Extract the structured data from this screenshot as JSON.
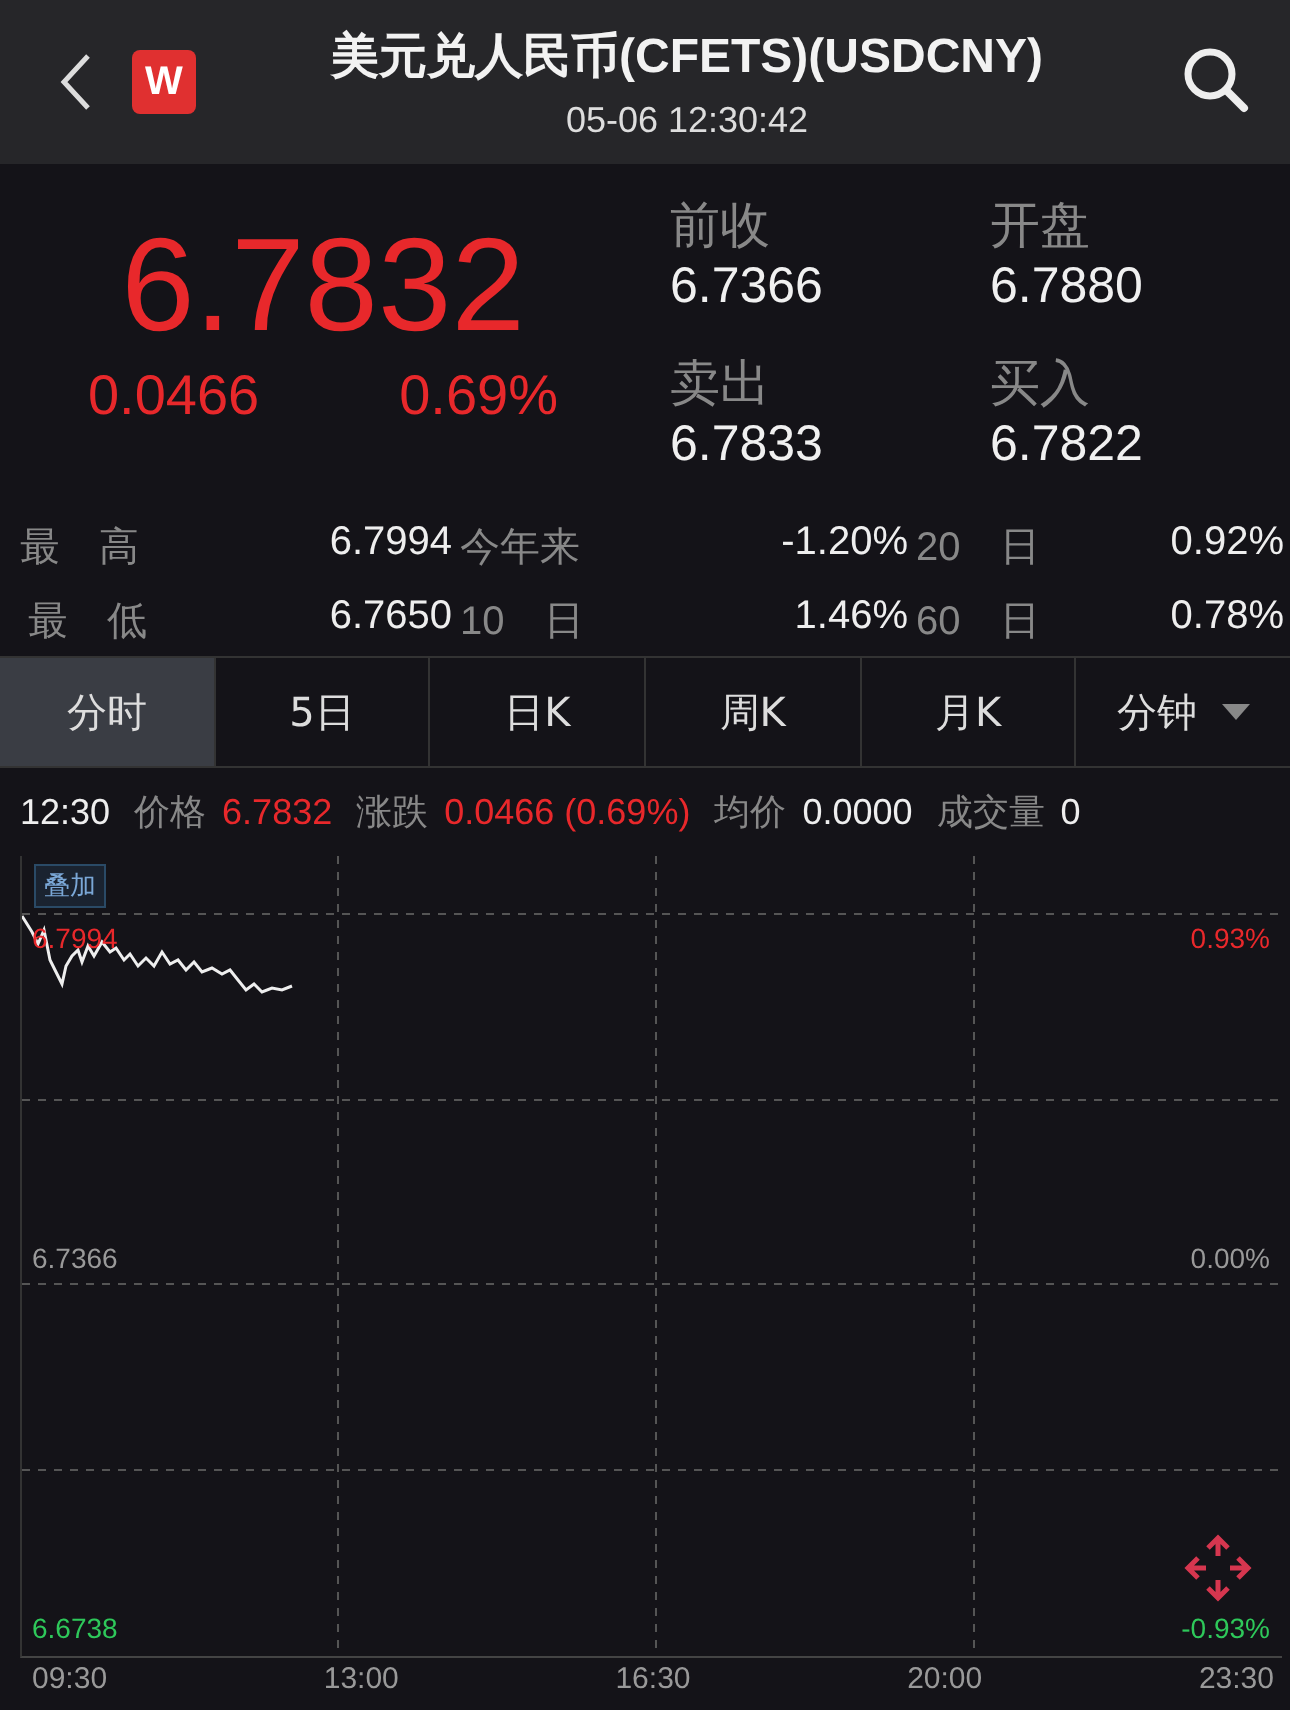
{
  "header": {
    "title": "美元兑人民币(CFETS)(USDCNY)",
    "time": "05-06 12:30:42",
    "logo": "W"
  },
  "quote": {
    "price": "6.7832",
    "change": "0.0466",
    "change_pct": "0.69%",
    "fields": [
      {
        "label": "前收",
        "value": "6.7366"
      },
      {
        "label": "开盘",
        "value": "6.7880"
      },
      {
        "label": "卖出",
        "value": "6.7833"
      },
      {
        "label": "买入",
        "value": "6.7822"
      }
    ]
  },
  "stats": [
    [
      {
        "label": "最 高",
        "value": "6.7994"
      },
      {
        "label": "今年来",
        "value": "-1.20%"
      },
      {
        "label": "20 日",
        "value": "0.92%"
      }
    ],
    [
      {
        "label": "最 低",
        "value": "6.7650"
      },
      {
        "label": "10 日",
        "value": "1.46%"
      },
      {
        "label": "60 日",
        "value": "0.78%"
      }
    ]
  ],
  "tabs": [
    {
      "label": "分时",
      "selected": true
    },
    {
      "label": "5日",
      "selected": false
    },
    {
      "label": "日K",
      "selected": false
    },
    {
      "label": "周K",
      "selected": false
    },
    {
      "label": "月K",
      "selected": false
    },
    {
      "label": "分钟",
      "selected": false,
      "dropdown": true
    }
  ],
  "info_time": "12:30",
  "info_bar": [
    {
      "label": "价格",
      "value": "6.7832",
      "color": "#e8282b"
    },
    {
      "label": "涨跌",
      "value": "0.0466 (0.69%)",
      "color": "#e8282b"
    },
    {
      "label": "均价",
      "value": "0.0000",
      "color": "#eeeeee"
    },
    {
      "label": "成交量",
      "value": "0",
      "color": "#eeeeee"
    }
  ],
  "chart": {
    "overlay_button": "叠加",
    "y_left": [
      {
        "text": "6.7994",
        "color": "#e8282b"
      },
      {
        "text": "6.7366",
        "color": "#999999"
      },
      {
        "text": "6.6738",
        "color": "#2ec85a"
      }
    ],
    "y_right": [
      {
        "text": "0.93%",
        "color": "#e8282b"
      },
      {
        "text": "0.00%",
        "color": "#999999"
      },
      {
        "text": "-0.93%",
        "color": "#2ec85a"
      }
    ],
    "x_labels": [
      "09:30",
      "13:00",
      "16:30",
      "20:00",
      "23:30"
    ]
  }
}
